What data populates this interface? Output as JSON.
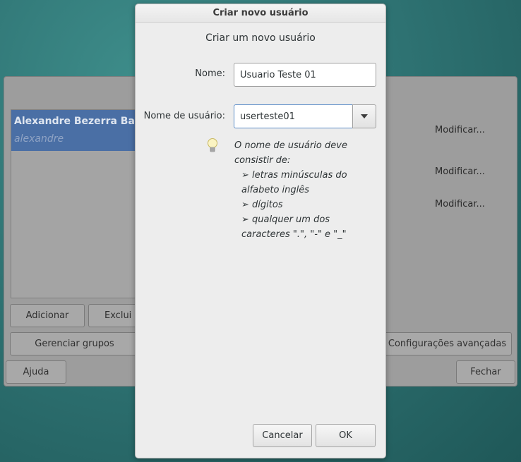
{
  "background_window": {
    "user": {
      "full_name": "Alexandre Bezerra Ba",
      "login": "alexandre"
    },
    "buttons": {
      "add": "Adicionar",
      "delete": "Exclui",
      "manage_groups": "Gerenciar grupos",
      "advanced_settings": "Configurações avançadas",
      "help": "Ajuda",
      "close": "Fechar"
    },
    "modify_links": [
      "Modificar...",
      "Modificar...",
      "Modificar..."
    ]
  },
  "dialog": {
    "title": "Criar novo usuário",
    "heading": "Criar um novo usuário",
    "name_label": "Nome:",
    "name_value": "Usuario Teste 01",
    "username_label": "Nome de usuário:",
    "username_value": "userteste01",
    "hint": {
      "intro": "O nome de usuário deve consistir de:",
      "bullets": [
        "➢  letras minúsculas do alfabeto inglês",
        "➢  dígitos",
        "➢  qualquer um dos caracteres \".\", \"-\" e \"_\""
      ]
    },
    "cancel_label": "Cancelar",
    "ok_label": "OK"
  }
}
